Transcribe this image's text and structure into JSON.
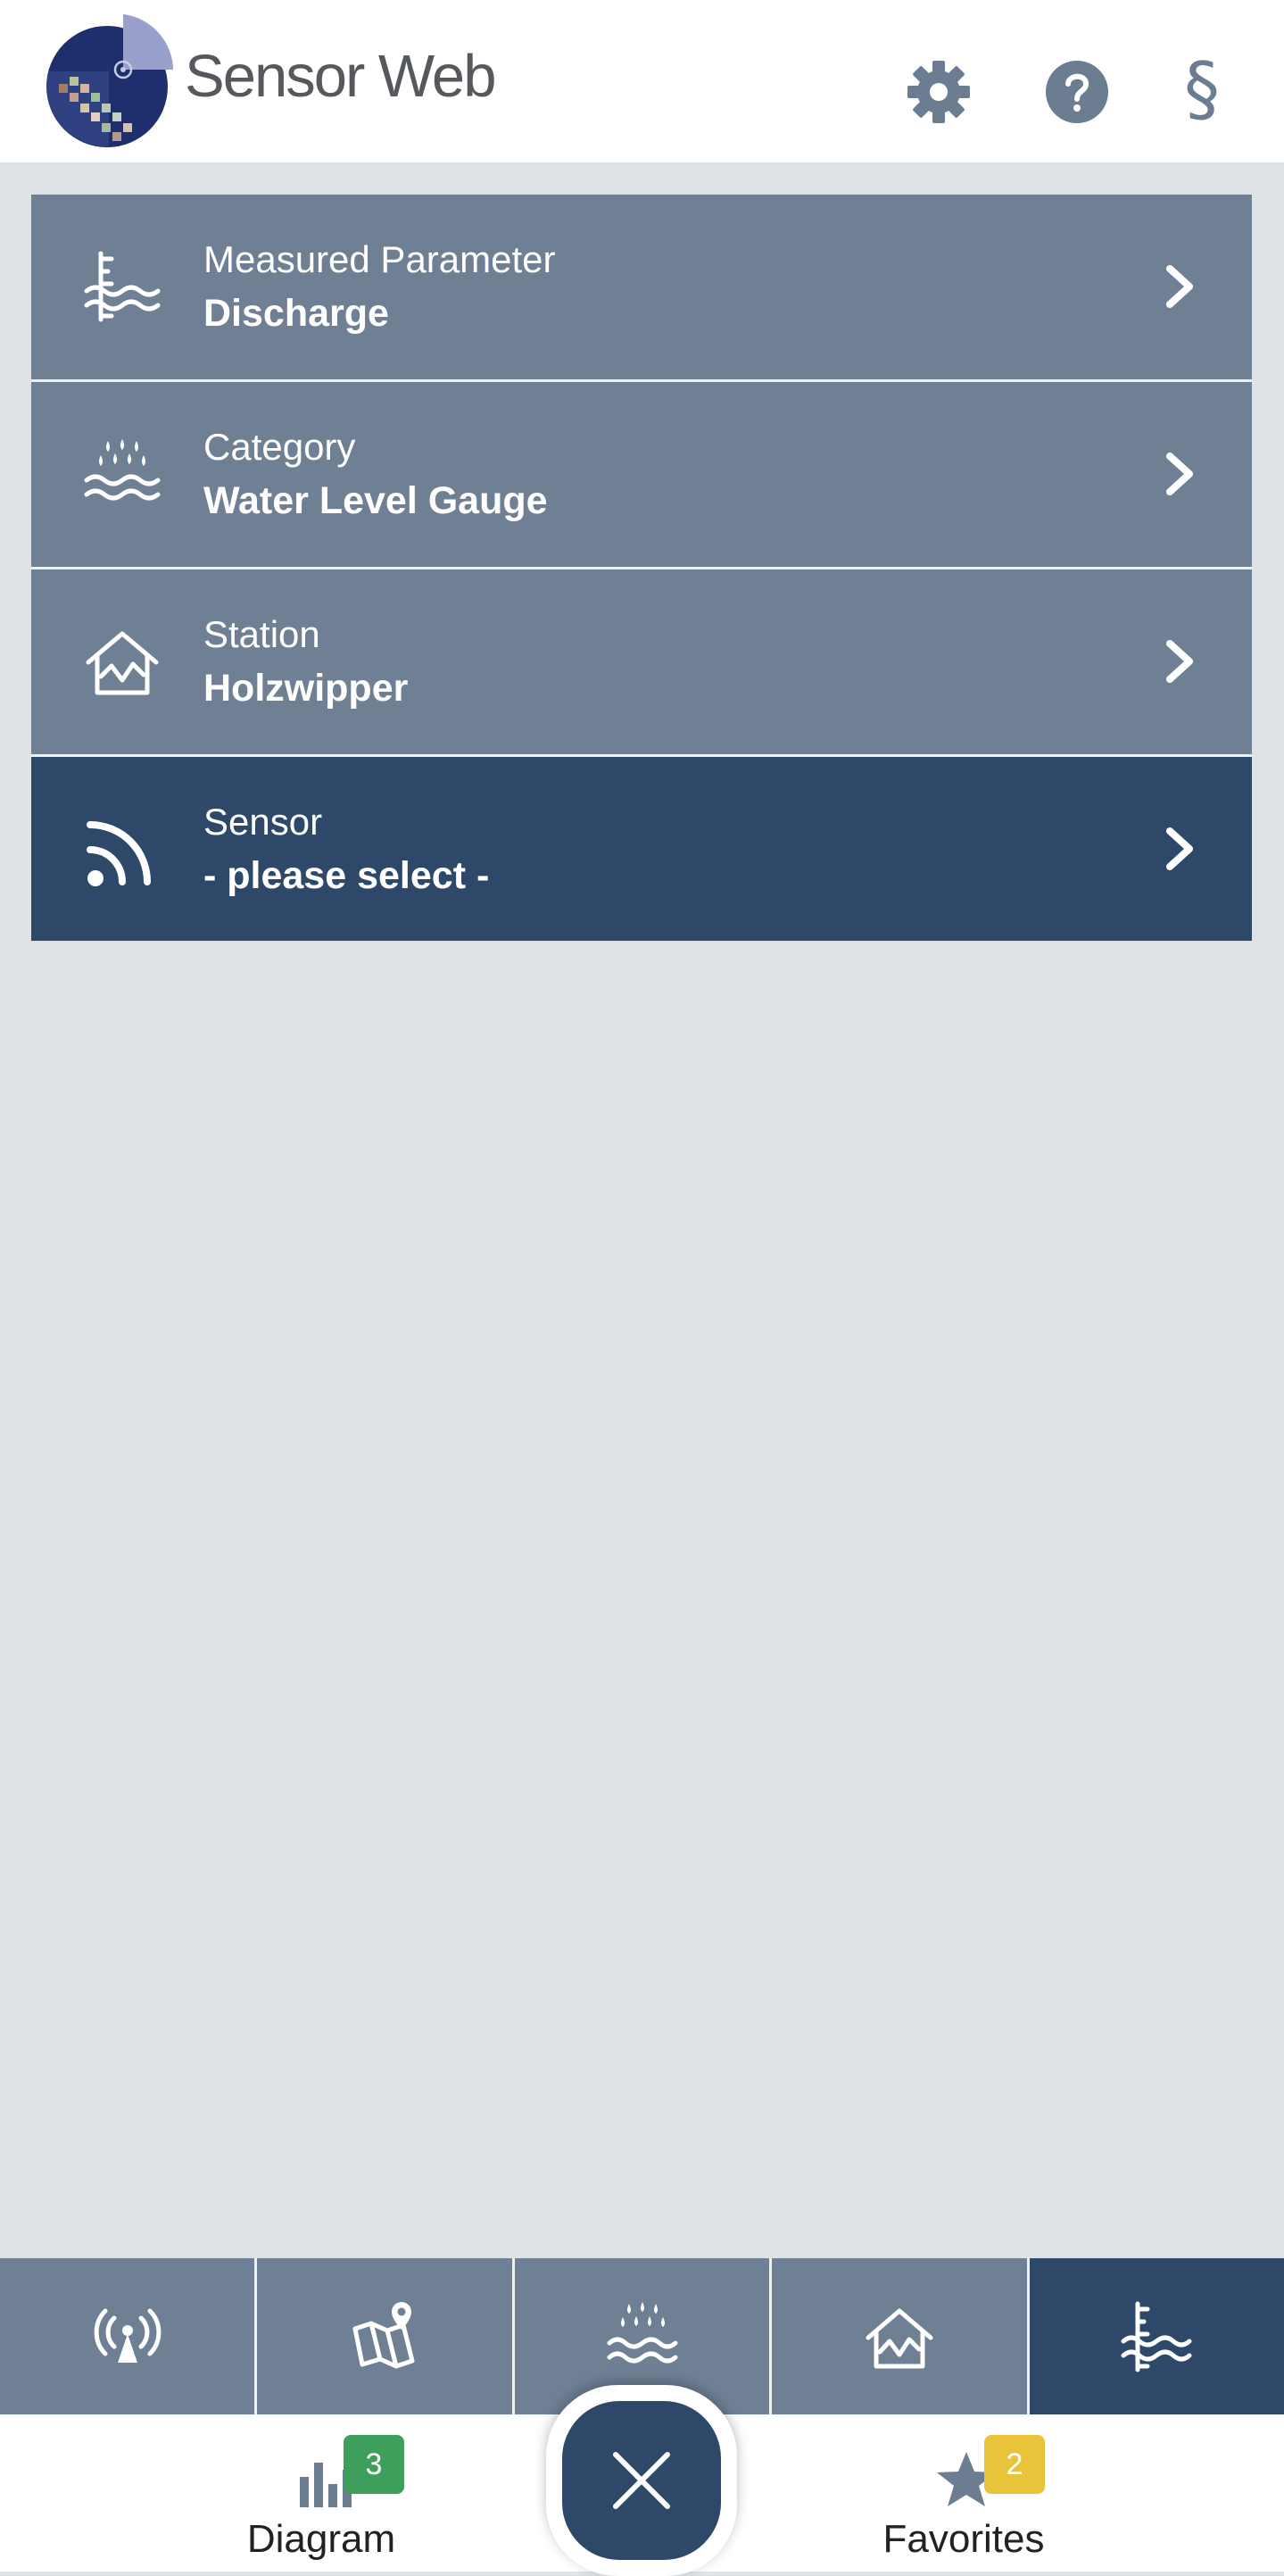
{
  "header": {
    "brand": "Sensor Web",
    "settings_icon": "gear-icon",
    "help_icon": "question-icon",
    "legal_icon": "section-sign-icon",
    "legal_glyph": "§",
    "colors": {
      "icon": "#6d7d91",
      "brand_text": "#55595e"
    }
  },
  "rows": [
    {
      "label": "Measured Parameter",
      "value": "Discharge",
      "icon": "water-level-icon",
      "active": false
    },
    {
      "label": "Category",
      "value": "Water Level Gauge",
      "icon": "rain-waves-icon",
      "active": false
    },
    {
      "label": "Station",
      "value": "Holzwipper",
      "icon": "station-house-icon",
      "active": false
    },
    {
      "label": "Sensor",
      "value": "- please select -",
      "icon": "signal-icon",
      "active": true
    }
  ],
  "tabs": [
    {
      "icon": "antenna-icon",
      "active": false
    },
    {
      "icon": "map-pin-icon",
      "active": false
    },
    {
      "icon": "rain-waves-icon",
      "active": false
    },
    {
      "icon": "station-house-icon",
      "active": false
    },
    {
      "icon": "water-level-icon",
      "active": true
    }
  ],
  "bottombar": {
    "diagram": {
      "label": "Diagram",
      "badge": "3",
      "icon": "bar-chart-icon",
      "badge_color": "#3e9f5c"
    },
    "favorites": {
      "label": "Favorites",
      "badge": "2",
      "icon": "star-icon",
      "badge_color": "#e9c33a"
    },
    "close_icon": "close-icon"
  },
  "colors": {
    "row_bg": "#6f8095",
    "row_active_bg": "#2d4869",
    "page_bg": "#dfe3e6"
  }
}
